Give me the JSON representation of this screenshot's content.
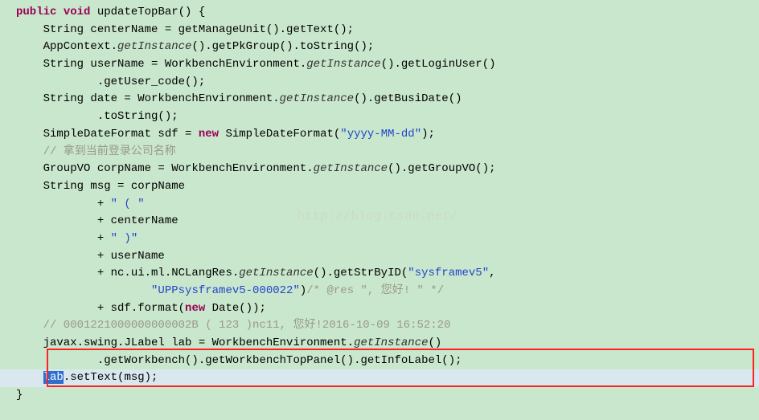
{
  "watermark": "http://blog.csdn.net/",
  "code": {
    "l1_kw1": "public",
    "l1_kw2": "void",
    "l1_rest": " updateTopBar() {",
    "l2": "    String centerName = getManageUnit().getText();",
    "l3_a": "    AppContext.",
    "l3_it": "getInstance",
    "l3_b": "().getPkGroup().toString();",
    "l4_a": "    String userName = WorkbenchEnvironment.",
    "l4_it": "getInstance",
    "l4_b": "().getLoginUser()",
    "l5": "            .getUser_code();",
    "l6_a": "    String date = WorkbenchEnvironment.",
    "l6_it": "getInstance",
    "l6_b": "().getBusiDate()",
    "l7": "            .toString();",
    "l8_a": "    SimpleDateFormat sdf = ",
    "l8_kw": "new",
    "l8_b": " SimpleDateFormat(",
    "l8_str": "\"yyyy-MM-dd\"",
    "l8_c": ");",
    "l9_cmt": "    // 拿到当前登录公司名称",
    "l10_a": "    GroupVO corpName = WorkbenchEnvironment.",
    "l10_it": "getInstance",
    "l10_b": "().getGroupVO();",
    "l11": "    String msg = corpName",
    "l12_a": "            + ",
    "l12_str": "\" ( \"",
    "l13": "            + centerName",
    "l14_a": "            + ",
    "l14_str": "\" )\"",
    "l15": "            + userName",
    "l16_a": "            + nc.ui.ml.NCLangRes.",
    "l16_it": "getInstance",
    "l16_b": "().getStrByID(",
    "l16_str": "\"sysframev5\"",
    "l16_c": ",",
    "l17_a": "                    ",
    "l17_str": "\"UPPsysframev5-000022\"",
    "l17_b": ")",
    "l17_cmt": "/* @res \", 您好! \" */",
    "l18_a": "            + sdf.format(",
    "l18_kw": "new",
    "l18_b": " Date());",
    "l19_cmt": "    // 0001221000000000002B ( 123 )nc11, 您好!2016-10-09 16:52:20",
    "l20_a": "    javax.swing.JLabel lab = WorkbenchEnvironment.",
    "l20_it": "getInstance",
    "l20_b": "()",
    "l21": "            .getWorkbench().getWorkbenchTopPanel().getInfoLabel();",
    "l22_a": "    ",
    "l22_sel": "lab",
    "l22_b": ".setText(msg);",
    "l23": "}"
  }
}
